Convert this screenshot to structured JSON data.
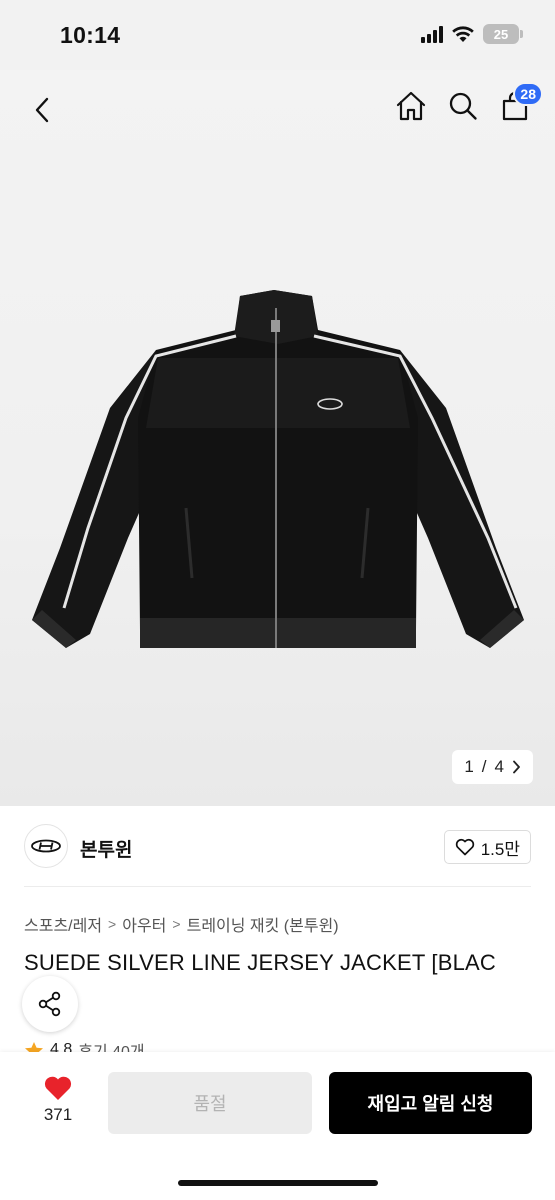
{
  "status_bar": {
    "time": "10:14",
    "battery": "25"
  },
  "header": {
    "cart_count": "28"
  },
  "gallery": {
    "current": "1",
    "separator": "/",
    "total": "4"
  },
  "brand": {
    "name": "본투윈",
    "likes": "1.5만"
  },
  "breadcrumb": [
    "스포츠/레저",
    "아우터",
    "트레이닝 재킷 (본투윈)"
  ],
  "product": {
    "title": "SUEDE SILVER LINE JERSEY JACKET [BLAC",
    "rating": "4.8",
    "reviews": "후기 40개"
  },
  "bottom": {
    "wish_count": "371",
    "soldout_label": "품절",
    "restock_label": "재입고 알림 신청"
  },
  "colors": {
    "badge": "#2f6bf6",
    "heart": "#e8232b",
    "star": "#f6a623",
    "primary_button": "#000000",
    "disabled_button": "#ececec"
  },
  "icons": [
    "back-icon",
    "home-icon",
    "search-icon",
    "cart-icon",
    "chevron-right-icon",
    "heart-outline-icon",
    "share-icon",
    "star-icon",
    "heart-filled-icon",
    "wifi-icon",
    "signal-icon",
    "battery-icon"
  ]
}
